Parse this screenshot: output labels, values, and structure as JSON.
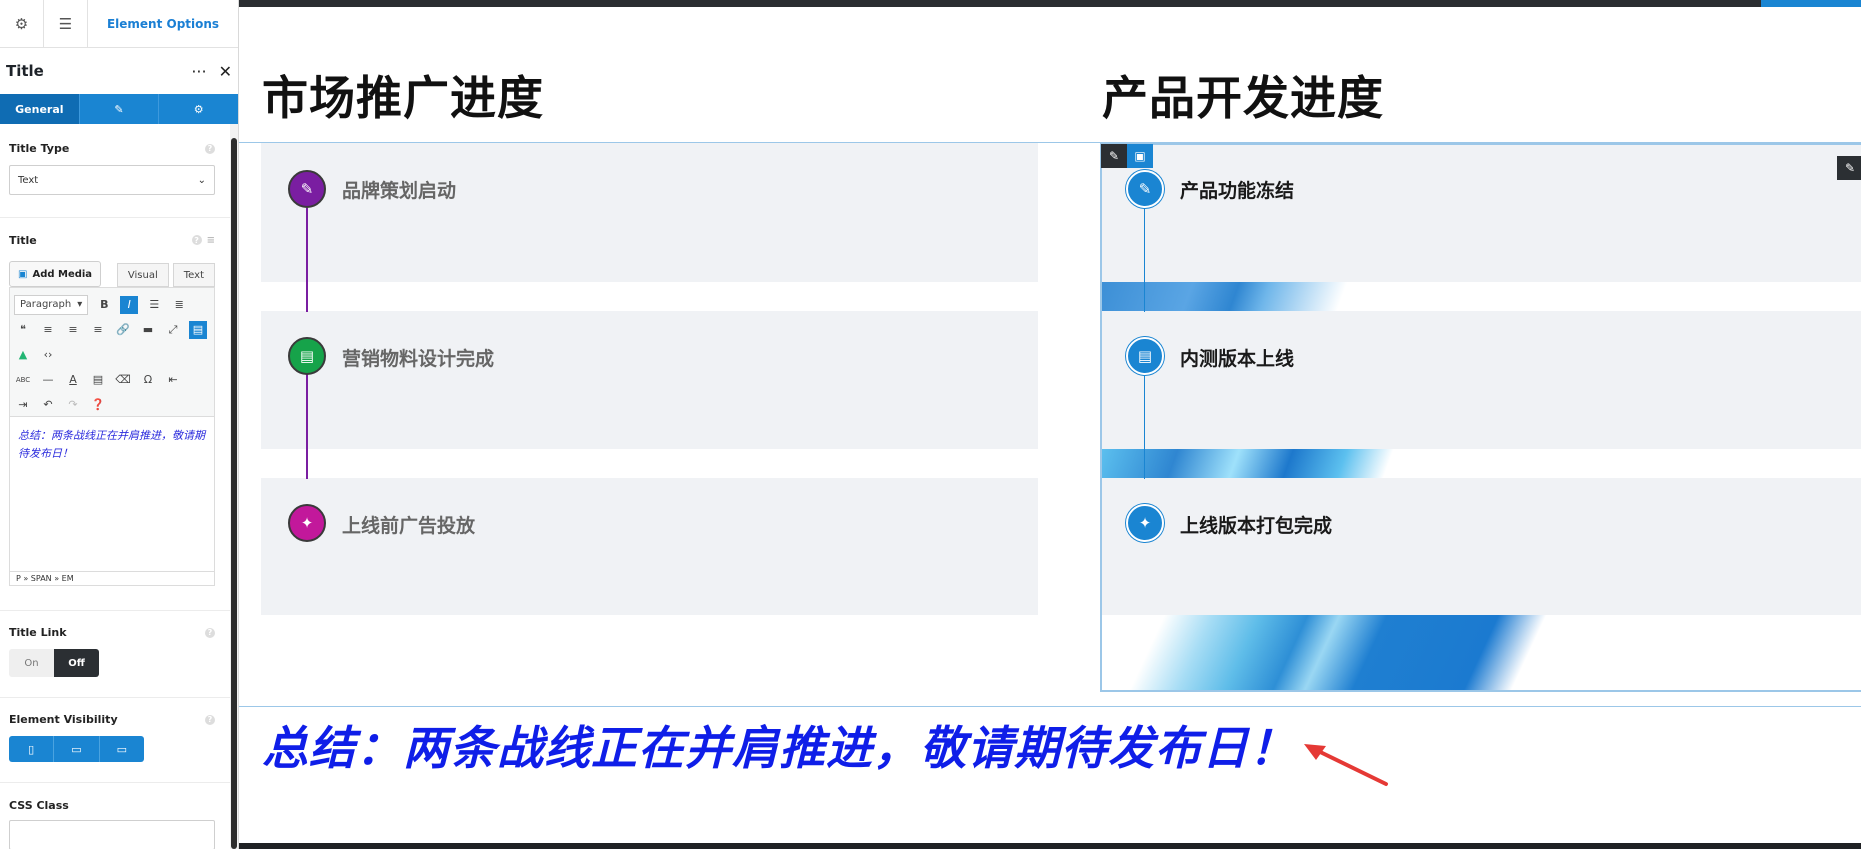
{
  "sidebar": {
    "tabs": {
      "settings_icon": "gear-icon",
      "sliders_icon": "sliders-icon",
      "active_label": "Element Options"
    },
    "header": {
      "title": "Title",
      "more_icon": "more-icon",
      "close_icon": "close-icon"
    },
    "subtabs": {
      "general": "General",
      "design_icon": "brush-icon",
      "advanced_icon": "gears-icon"
    },
    "title_type": {
      "label": "Title Type",
      "value": "Text"
    },
    "title": {
      "label": "Title",
      "add_media": "Add Media",
      "visual_tab": "Visual",
      "text_tab": "Text",
      "format_select": "Paragraph",
      "content": "总结：两条战线正在并肩推进，敬请期待发布日！",
      "path": "P » SPAN » EM"
    },
    "title_link": {
      "label": "Title Link",
      "on": "On",
      "off": "Off"
    },
    "element_visibility": {
      "label": "Element Visibility"
    },
    "css_class": {
      "label": "CSS Class",
      "value": ""
    }
  },
  "canvas": {
    "left_heading": "市场推广进度",
    "right_heading": "产品开发进度",
    "left_items": [
      {
        "text": "品牌策划启动",
        "icon": "brush-icon",
        "color": "#7a1ea1"
      },
      {
        "text": "营销物料设计完成",
        "icon": "document-icon",
        "color": "#16a34a"
      },
      {
        "text": "上线前广告投放",
        "icon": "puzzle-icon",
        "color": "#c2189b"
      }
    ],
    "right_items": [
      {
        "text": "产品功能冻结",
        "icon": "brush-icon",
        "color": "#1a85d2"
      },
      {
        "text": "内测版本上线",
        "icon": "document-icon",
        "color": "#1a85d2"
      },
      {
        "text": "上线版本打包完成",
        "icon": "puzzle-icon",
        "color": "#1a85d2"
      }
    ],
    "summary": "总结：两条战线正在并肩推进，敬请期待发布日！"
  }
}
